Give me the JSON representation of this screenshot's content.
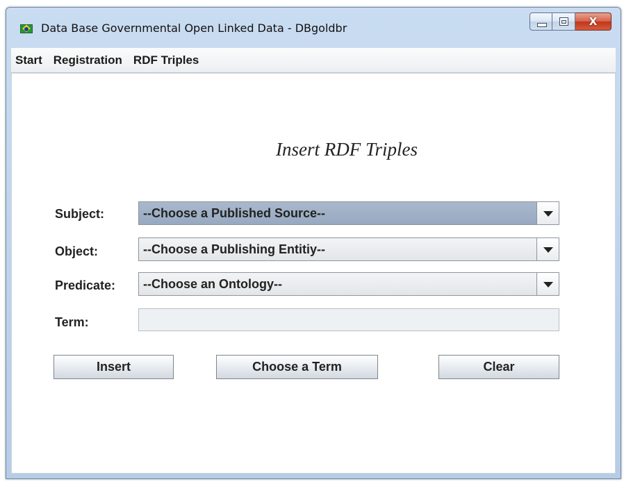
{
  "window": {
    "title": "Data Base Governmental Open Linked Data - DBgoldbr",
    "close_glyph": "X"
  },
  "icons": {
    "app_icon": "brazil-flag-icon",
    "minimize": "minimize-icon",
    "maximize": "maximize-icon",
    "close": "close-icon",
    "dropdown": "chevron-down-icon"
  },
  "menu": {
    "items": [
      "Start",
      "Registration",
      "RDF Triples"
    ]
  },
  "form": {
    "heading": "Insert RDF Triples",
    "subject": {
      "label": "Subject:",
      "value": "--Choose a Published Source--"
    },
    "object": {
      "label": "Object:",
      "value": "--Choose a Publishing Entitiy--"
    },
    "predicate": {
      "label": "Predicate:",
      "value": "--Choose an Ontology--"
    },
    "term": {
      "label": "Term:",
      "value": ""
    }
  },
  "buttons": {
    "insert": "Insert",
    "choose_term": "Choose a Term",
    "clear": "Clear"
  },
  "colors": {
    "titlebar": "#c9dcf1",
    "selected_combo": "#a9b8cc",
    "close_button": "#c2351a"
  }
}
